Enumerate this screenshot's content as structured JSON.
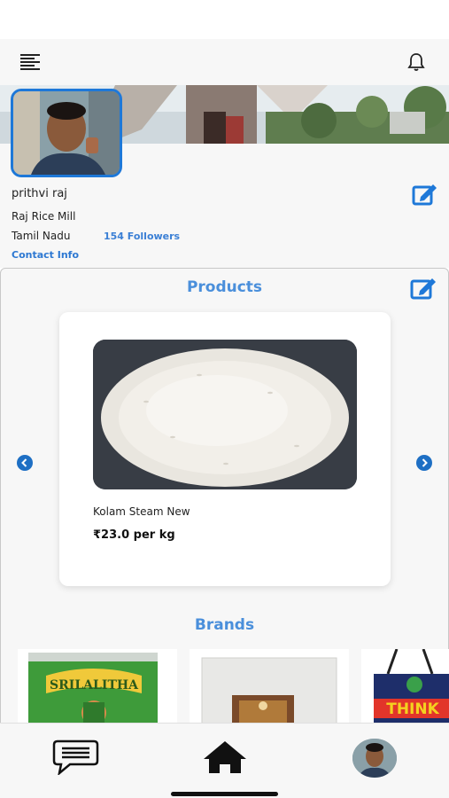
{
  "topbar": {
    "menu_icon": "menu-lines-icon",
    "bell_icon": "bell-icon"
  },
  "profile": {
    "name": "prithvi raj",
    "business": "Raj Rice Mill",
    "state": "Tamil Nadu",
    "followers": "154 Followers",
    "contact": "Contact Info",
    "edit_icon": "edit-square-icon"
  },
  "products": {
    "title": "Products",
    "edit_icon": "edit-square-icon",
    "current": {
      "name": "Kolam Steam New",
      "price": "₹23.0 per kg"
    },
    "prev_icon": "chevron-left-circle-icon",
    "next_icon": "chevron-right-circle-icon"
  },
  "brands": {
    "title": "Brands",
    "items": [
      {
        "label": "SRILALITHA"
      },
      {
        "label": ""
      },
      {
        "label": "THINK"
      }
    ]
  },
  "bottom_nav": {
    "chat_icon": "chat-bubble-icon",
    "home_icon": "home-icon",
    "profile_icon": "avatar"
  },
  "colors": {
    "accent": "#4a8fdb",
    "link": "#2d78d2",
    "avatar_border": "#1e78d8"
  }
}
